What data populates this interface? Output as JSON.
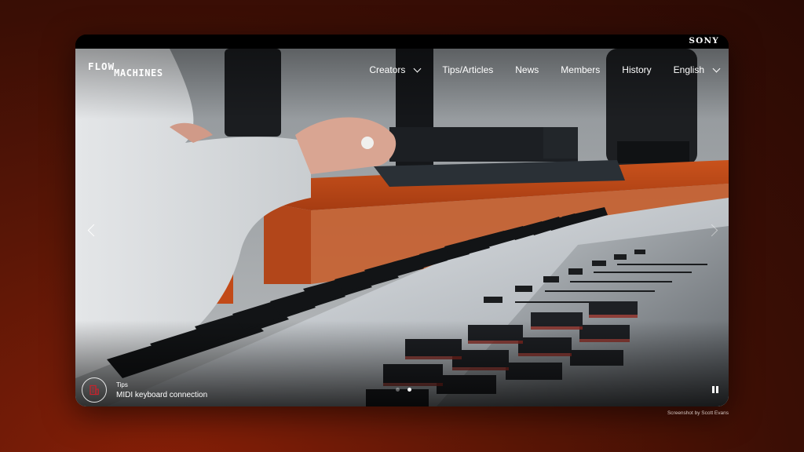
{
  "brand": {
    "corporate": "SONY",
    "logo_line1": "FLOW",
    "logo_line2": "MACHINES"
  },
  "nav": {
    "items": [
      {
        "label": "Creators",
        "has_dropdown": true
      },
      {
        "label": "Tips/Articles",
        "has_dropdown": false
      },
      {
        "label": "News",
        "has_dropdown": false
      },
      {
        "label": "Members",
        "has_dropdown": false
      },
      {
        "label": "History",
        "has_dropdown": false
      },
      {
        "label": "English",
        "has_dropdown": true
      }
    ]
  },
  "hero": {
    "prev_icon": "chevron-left-icon",
    "next_icon": "chevron-right-icon",
    "caption": {
      "icon": "document-icon",
      "category": "Tips",
      "title": "MIDI keyboard connection"
    },
    "slides_total": 2,
    "active_slide": 2,
    "pause_icon": "pause-icon"
  },
  "colors": {
    "accent_red": "#c8232c",
    "background_dark_red": "#5a1606"
  },
  "credit": "Screenshot by Scott Evans"
}
